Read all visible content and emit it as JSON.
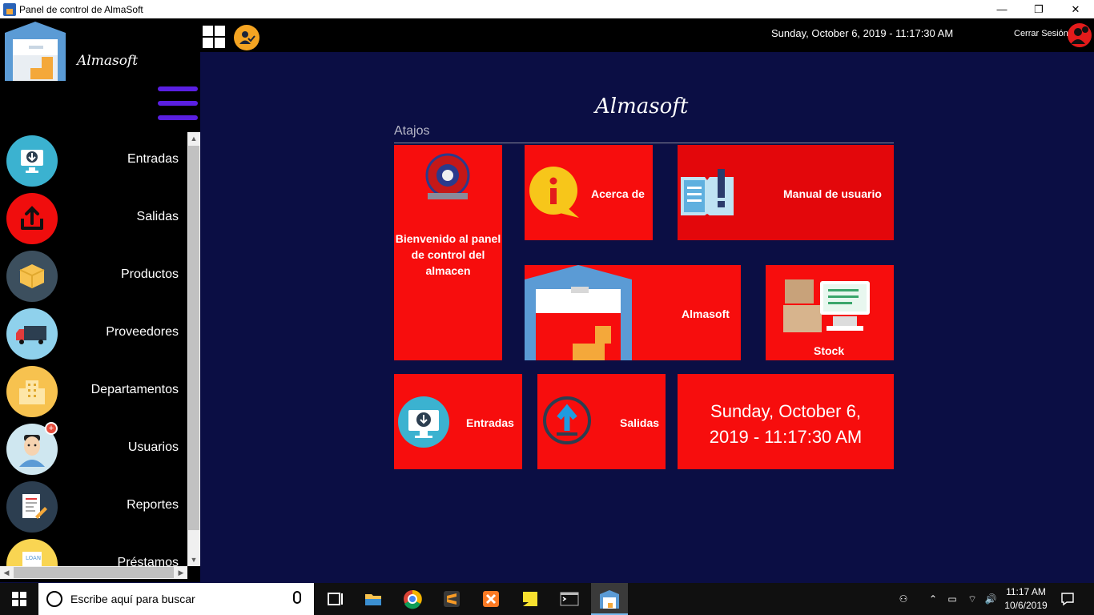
{
  "window": {
    "title": "Panel de control de AlmaSoft",
    "minimize_glyph": "—",
    "maximize_glyph": "❐",
    "close_glyph": "✕"
  },
  "header": {
    "datetime": "Sunday, October 6, 2019 - 11:17:30 AM",
    "logout_label": "Cerrar Sesión"
  },
  "sidebar": {
    "logo_text": "Almasoft",
    "items": [
      {
        "label": "Entradas",
        "icon": "download-monitor-icon",
        "color": "#3bb2d0"
      },
      {
        "label": "Salidas",
        "icon": "upload-icon",
        "color": "#f00d0d"
      },
      {
        "label": "Productos",
        "icon": "box-icon",
        "color": "#3c4f5e"
      },
      {
        "label": "Proveedores",
        "icon": "truck-icon",
        "color": "#8fd1ec"
      },
      {
        "label": "Departamentos",
        "icon": "building-icon",
        "color": "#f7c24f"
      },
      {
        "label": "Usuarios",
        "icon": "user-icon",
        "color": "#cfe7f0"
      },
      {
        "label": "Reportes",
        "icon": "report-icon",
        "color": "#2c3e50"
      },
      {
        "label": "Préstamos",
        "icon": "loan-icon",
        "color": "#f9d552"
      }
    ]
  },
  "main": {
    "title": "Almasoft",
    "section_label": "Atajos",
    "tiles": {
      "welcome": "Bienvenido al panel de control del almacen",
      "about": "Acerca de",
      "manual": "Manual de usuario",
      "almasoft": "Almasoft",
      "stock": "Stock",
      "entradas": "Entradas",
      "salidas": "Salidas",
      "clock_line1": "Sunday, October 6,",
      "clock_line2": "2019 - 11:17:30 AM"
    },
    "tile_color": "#f70d0d"
  },
  "taskbar": {
    "search_placeholder": "Escribe aquí para buscar",
    "time": "11:17 AM",
    "date": "10/6/2019"
  }
}
